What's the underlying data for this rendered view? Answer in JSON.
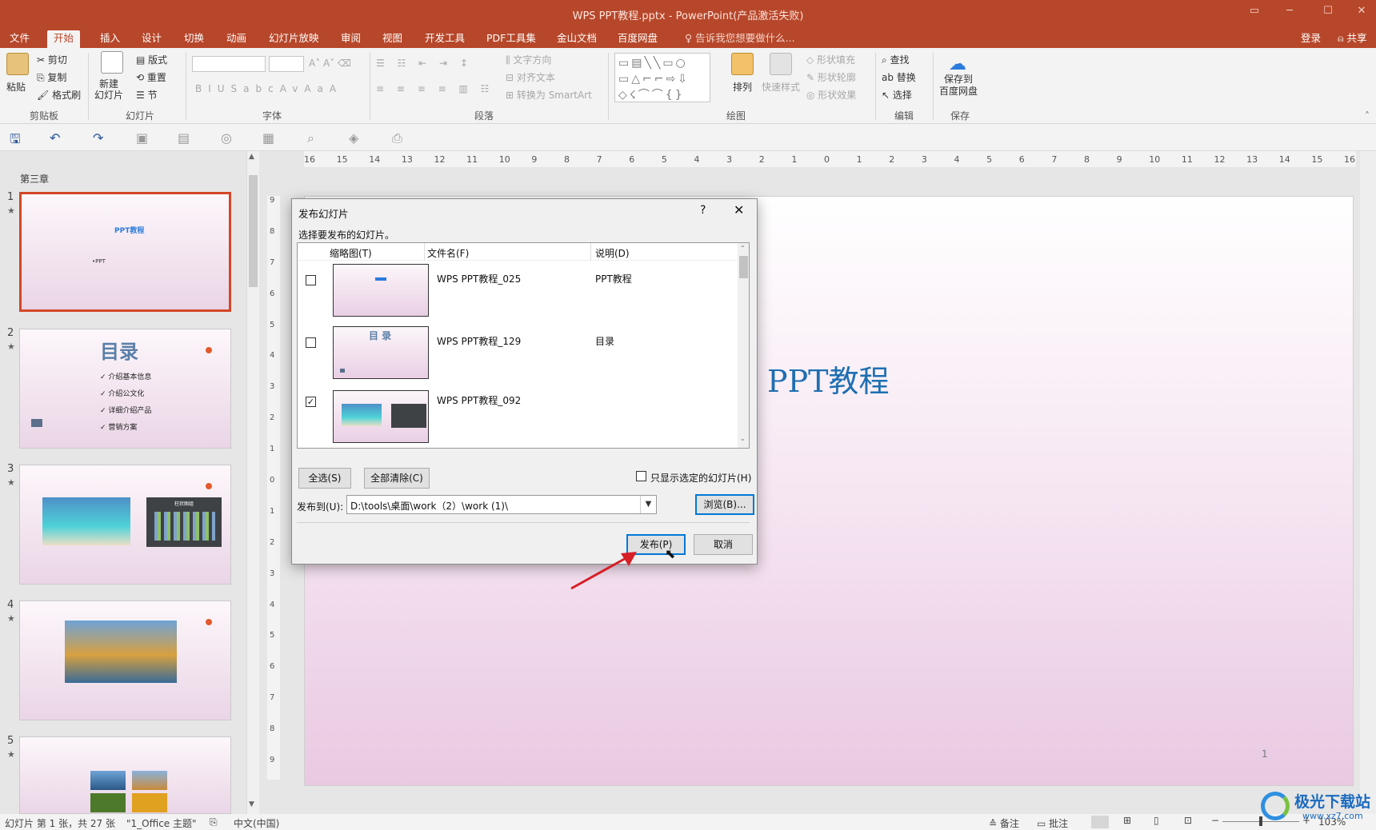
{
  "window": {
    "title": "WPS PPT教程.pptx - PowerPoint(产品激活失败)"
  },
  "tabs": [
    "文件",
    "开始",
    "插入",
    "设计",
    "切换",
    "动画",
    "幻灯片放映",
    "审阅",
    "视图",
    "开发工具",
    "PDF工具集",
    "金山文档",
    "百度网盘"
  ],
  "tell_me": "告诉我您想要做什么...",
  "account": {
    "login": "登录",
    "share": "共享"
  },
  "ribbon": {
    "clipboard": {
      "paste": "粘贴",
      "cut": "剪切",
      "copy": "复制",
      "format_painter": "格式刷",
      "label": "剪贴板"
    },
    "slides": {
      "new_slide": "新建\n幻灯片",
      "layout": "版式",
      "reset": "重置",
      "section": "节",
      "label": "幻灯片"
    },
    "font": {
      "label": "字体"
    },
    "paragraph": {
      "text_direction": "文字方向",
      "align_text": "对齐文本",
      "convert_smartart": "转换为 SmartArt",
      "label": "段落"
    },
    "drawing": {
      "arrange": "排列",
      "quick_styles": "快速样式",
      "shape_fill": "形状填充",
      "shape_outline": "形状轮廓",
      "shape_effects": "形状效果",
      "label": "绘图"
    },
    "editing": {
      "find": "查找",
      "replace": "替换",
      "select": "选择",
      "label": "编辑"
    },
    "save": {
      "save_to_baidu": "保存到\n百度网盘",
      "label": "保存"
    }
  },
  "ruler": {
    "h_ticks": [
      "16",
      "15",
      "14",
      "13",
      "12",
      "11",
      "10",
      "9",
      "8",
      "7",
      "6",
      "5",
      "4",
      "3",
      "2",
      "1",
      "0",
      "1",
      "2",
      "3",
      "4",
      "5",
      "6",
      "7",
      "8",
      "9",
      "10",
      "11",
      "12",
      "13",
      "14",
      "15",
      "16"
    ],
    "v_ticks": [
      "9",
      "8",
      "7",
      "6",
      "5",
      "4",
      "3",
      "2",
      "1",
      "0",
      "1",
      "2",
      "3",
      "4",
      "5",
      "6",
      "7",
      "8",
      "9"
    ]
  },
  "slide_panel": {
    "section": "第三章",
    "slides": [
      {
        "num": "1",
        "title": "PPT教程",
        "bullet": "•PPT"
      },
      {
        "num": "2",
        "title": "目录",
        "items": [
          "介绍基本信息",
          "介绍公文化",
          "详细介绍产品",
          "营销方案"
        ]
      },
      {
        "num": "3",
        "chart_title": "柱状图组"
      },
      {
        "num": "4"
      },
      {
        "num": "5"
      }
    ]
  },
  "main_slide": {
    "title": "PPT教程",
    "page_number": "1"
  },
  "dialog": {
    "title": "发布幻灯片",
    "help": "?",
    "instruction": "选择要发布的幻灯片。",
    "columns": [
      "缩略图(T)",
      "文件名(F)",
      "说明(D)"
    ],
    "rows": [
      {
        "checked": false,
        "filename": "WPS PPT教程_025",
        "description": "PPT教程"
      },
      {
        "checked": true,
        "filename": "WPS PPT教程_129",
        "description": "目录"
      },
      {
        "checked": true,
        "filename": "WPS PPT教程_092",
        "description": ""
      }
    ],
    "select_all": "全选(S)",
    "clear_all": "全部清除(C)",
    "only_selected": "只显示选定的幻灯片(H)",
    "publish_to_label": "发布到(U):",
    "publish_to_value": "D:\\tools\\桌面\\work（2）\\work (1)\\",
    "browse": "浏览(B)...",
    "publish": "发布(P)",
    "cancel": "取消"
  },
  "status": {
    "slide_info": "幻灯片 第 1 张，共 27 张",
    "theme": "\"1_Office 主题\"",
    "language": "中文(中国)",
    "notes": "备注",
    "comments": "批注",
    "zoom": "103%"
  },
  "watermark": {
    "text": "极光下载站",
    "url": "www.xz7.com"
  },
  "colors": {
    "accent": "#b7472a",
    "selection": "#d24726",
    "title_blue": "#1f6fb2"
  }
}
